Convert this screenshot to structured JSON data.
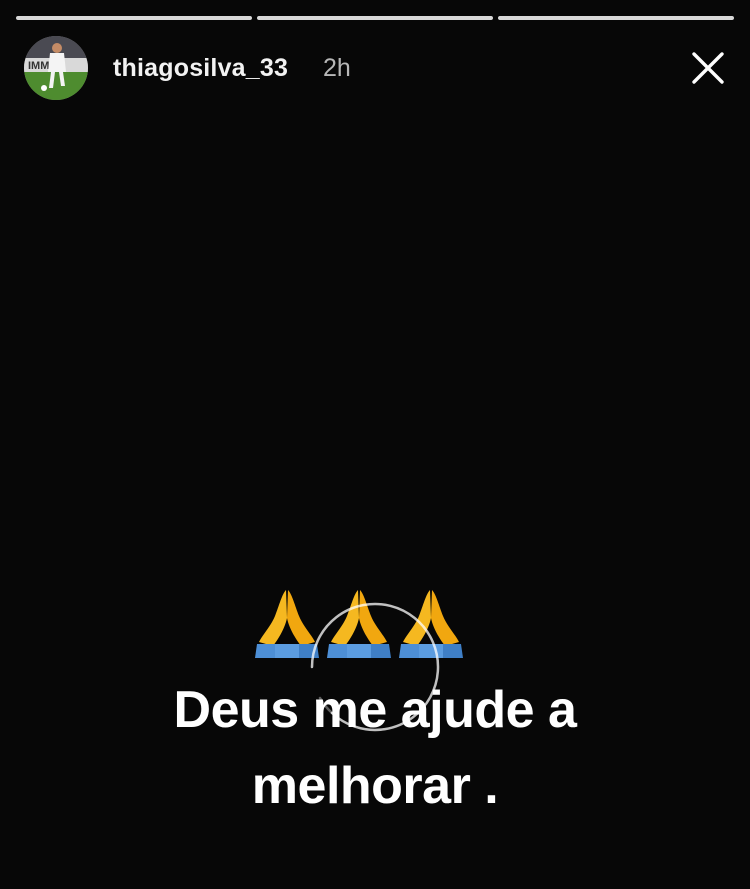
{
  "story": {
    "progress": [
      {
        "label": "segment-1",
        "fill": 1.0
      },
      {
        "label": "segment-2",
        "fill": 1.0
      },
      {
        "label": "segment-3",
        "fill": 1.0
      }
    ],
    "header": {
      "username": "thiagosilva_33",
      "time": "2h",
      "close_icon": "close-icon",
      "avatar_icon": "avatar-photo"
    },
    "content": {
      "emoji": "🙏🙏🙏",
      "caption_line1": "Deus me ajude a",
      "caption_line2": "melhorar ."
    },
    "colors": {
      "background": "#070707",
      "progress_fill": "#d8d8d8",
      "text": "#ffffff",
      "time_text": "#b7b7b7",
      "emoji_skin": "#f5b820",
      "emoji_sleeve": "#4d8fd6"
    }
  }
}
